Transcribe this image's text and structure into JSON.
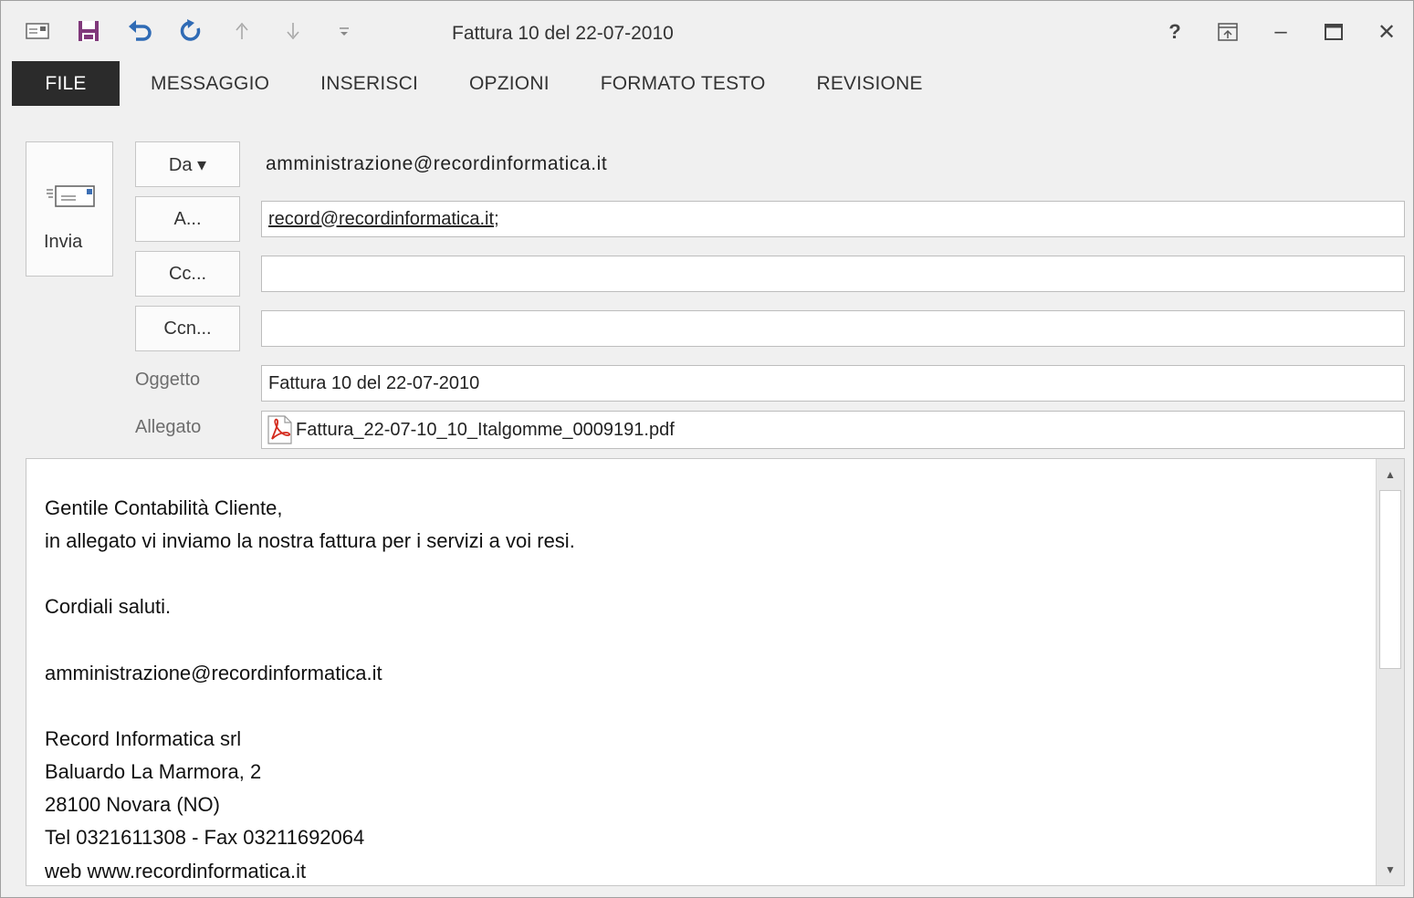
{
  "window": {
    "title": "Fattura 10 del 22-07-2010",
    "controls": {
      "help": "?",
      "minimize": "–",
      "maximize": "☐",
      "close": "✕"
    }
  },
  "ribbon": {
    "tabs": [
      "FILE",
      "MESSAGGIO",
      "INSERISCI",
      "OPZIONI",
      "FORMATO TESTO",
      "REVISIONE"
    ]
  },
  "header": {
    "send_label": "Invia",
    "from_button": "Da ▾",
    "from_value": "amministrazione@recordinformatica.it",
    "to_button": "A...",
    "to_value": "record@recordinformatica.it",
    "to_separator": ";",
    "cc_button": "Cc...",
    "cc_value": "",
    "bcc_button": "Ccn...",
    "bcc_value": "",
    "subject_label": "Oggetto",
    "subject_value": "Fattura 10 del 22-07-2010",
    "attachment_label": "Allegato",
    "attachment_value": "Fattura_22-07-10_10_Italgomme_0009191.pdf"
  },
  "body": {
    "lines": [
      "Gentile Contabilità Cliente,",
      "in allegato vi inviamo la nostra fattura per i servizi a voi resi.",
      "",
      "Cordiali saluti.",
      "",
      "amministrazione@recordinformatica.it",
      "",
      "Record Informatica srl",
      "Baluardo La Marmora, 2",
      "28100 Novara (NO)",
      "Tel 0321611308 - Fax 03211692064",
      "web www.recordinformatica.it"
    ]
  },
  "colors": {
    "file_tab_bg": "#2b2b2b",
    "save_icon": "#80397b",
    "undo_icon": "#2f6bb5",
    "pdf_icon": "#d42b1e"
  }
}
